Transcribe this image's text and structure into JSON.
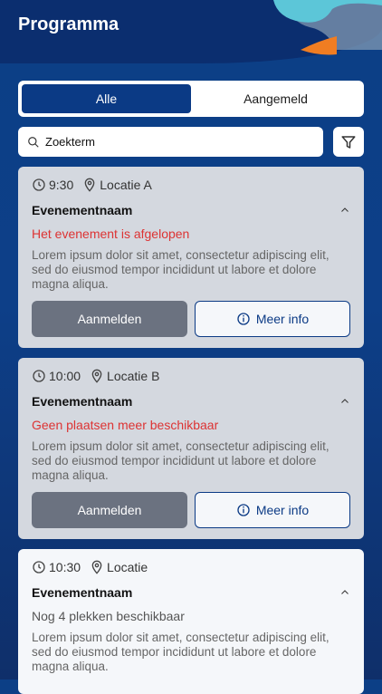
{
  "header": {
    "title": "Programma"
  },
  "tabs": [
    {
      "label": "Alle",
      "active": true
    },
    {
      "label": "Aangemeld",
      "active": false
    }
  ],
  "search": {
    "value": "Zoekterm"
  },
  "events": [
    {
      "time": "9:30",
      "location": "Locatie A",
      "name": "Evenementnaam",
      "status": "Het evenement is afgelopen",
      "description": "Lorem ipsum dolor sit amet, consectetur adipiscing elit, sed do eiusmod tempor incididunt ut labore et dolore magna aliqua.",
      "register_label": "Aanmelden",
      "info_label": "Meer info"
    },
    {
      "time": "10:00",
      "location": "Locatie B",
      "name": "Evenementnaam",
      "status": "Geen plaatsen meer beschikbaar",
      "description": "Lorem ipsum dolor sit amet, consectetur adipiscing elit, sed do eiusmod tempor incididunt ut labore et dolore magna aliqua.",
      "register_label": "Aanmelden",
      "info_label": "Meer info"
    },
    {
      "time": "10:30",
      "location": "Locatie",
      "name": "Evenementnaam",
      "status": "Nog 4 plekken beschikbaar",
      "description": "Lorem ipsum dolor sit amet, consectetur adipiscing elit, sed do eiusmod tempor incididunt ut labore et dolore magna aliqua."
    }
  ]
}
